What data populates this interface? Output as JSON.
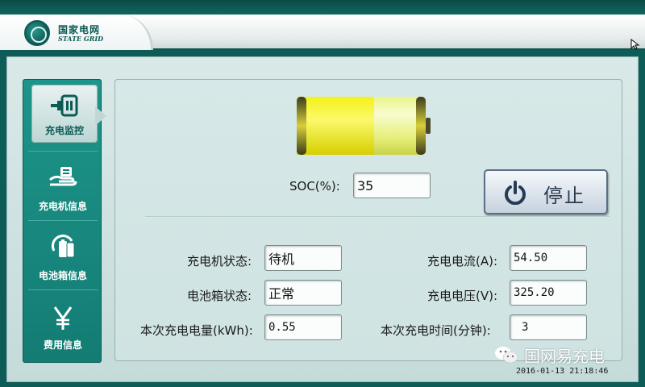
{
  "header": {
    "logo_cn": "国家电网",
    "logo_en": "STATE GRID"
  },
  "sidebar": {
    "items": [
      {
        "label": "充电监控",
        "icon": "charging-plug-icon",
        "active": true
      },
      {
        "label": "充电机信息",
        "icon": "charger-hand-icon",
        "active": false
      },
      {
        "label": "电池箱信息",
        "icon": "battery-box-icon",
        "active": false
      },
      {
        "label": "费用信息",
        "icon": "yen-icon",
        "active": false
      }
    ]
  },
  "monitor": {
    "battery_icon": "battery-level-icon",
    "soc_label": "SOC(%):",
    "soc_value": "35",
    "stop_button_label": "停止",
    "stop_icon": "power-icon",
    "charger_state_label": "充电机状态:",
    "charger_state_value": "待机",
    "battery_box_state_label": "电池箱状态:",
    "battery_box_state_value": "正常",
    "energy_label": "本次充电电量(kWh):",
    "energy_value": "0.55",
    "current_label": "充电电流(A):",
    "current_value": "54.50",
    "voltage_label": "充电电压(V):",
    "voltage_value": "325.20",
    "duration_label": "本次充电时间(分钟):",
    "duration_value": "3"
  },
  "overlay": {
    "watermark_text": "国网易充电",
    "timestamp": "2016-01-13 21:18:46"
  },
  "colors": {
    "brand_teal": "#137c73",
    "battery_yellow": "#f2f018"
  }
}
